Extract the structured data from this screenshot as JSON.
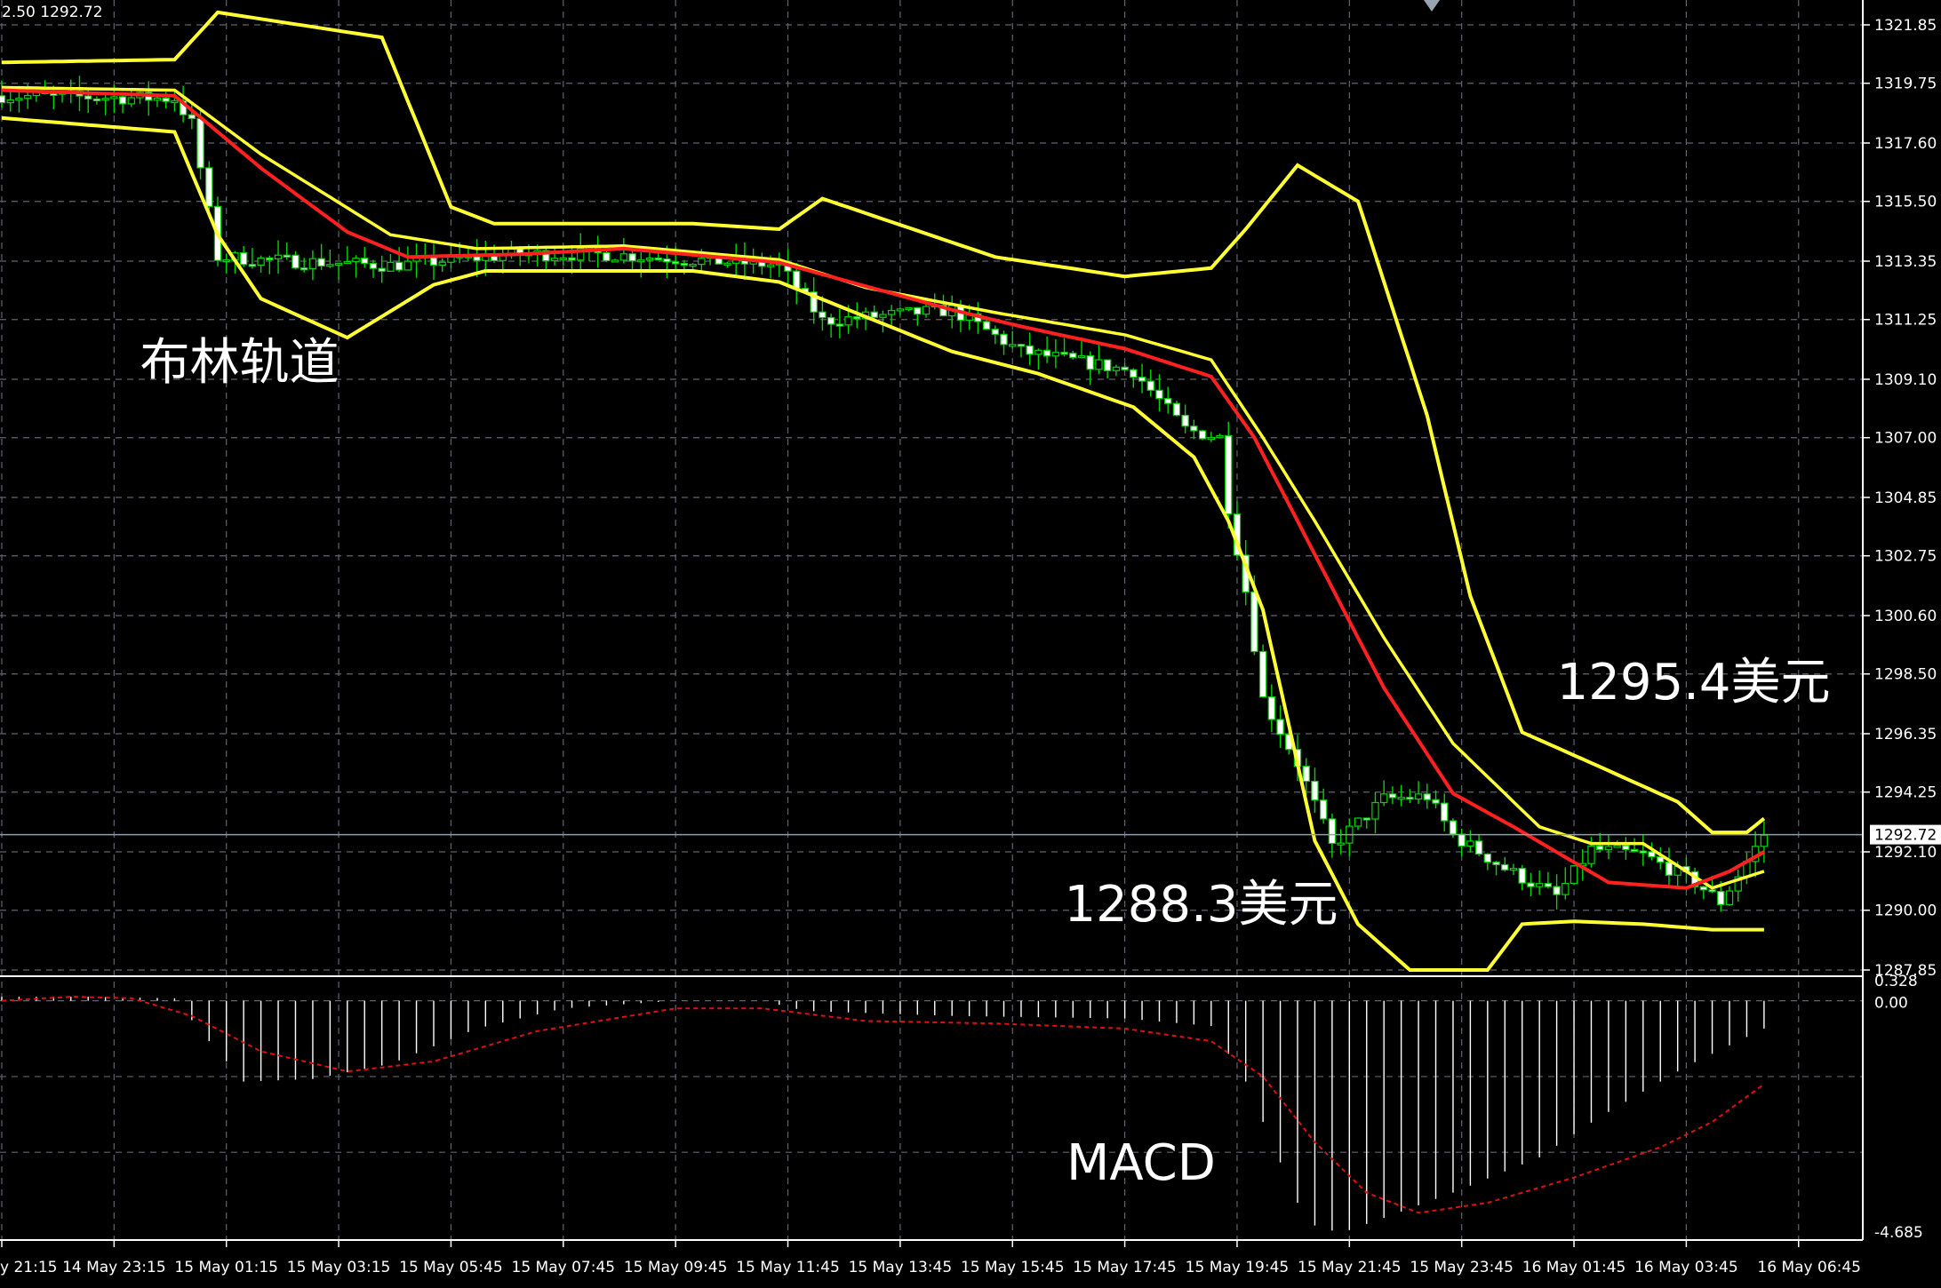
{
  "header": {
    "info": "2.50 1292.72"
  },
  "chart_data": [
    {
      "type": "candlestick",
      "overlays": [
        "bollinger-bands",
        "moving-average"
      ],
      "grid": true,
      "grid_style": "dashed",
      "background": "#000000",
      "current_price": 1292.72,
      "ylim": [
        1287.85,
        1321.85
      ],
      "y_ticks": [
        1321.85,
        1319.75,
        1317.6,
        1315.5,
        1313.35,
        1311.25,
        1309.1,
        1307.0,
        1304.85,
        1302.75,
        1300.6,
        1298.5,
        1296.35,
        1294.25,
        1292.1,
        1290.0,
        1287.85
      ],
      "y_tick_labels": [
        "1321.85",
        "1319.75",
        "1317.60",
        "1315.50",
        "1313.35",
        "1311.25",
        "1309.10",
        "1307.00",
        "1304.85",
        "1302.75",
        "1300.60",
        "1298.50",
        "1296.35",
        "1294.25",
        "1292.10",
        "1290.00",
        "1287.85"
      ],
      "x_ticks": [
        "y 21:15",
        "14 May 23:15",
        "15 May 01:15",
        "15 May 03:15",
        "15 May 05:45",
        "15 May 07:45",
        "15 May 09:45",
        "15 May 11:45",
        "15 May 13:45",
        "15 May 15:45",
        "15 May 17:45",
        "15 May 19:45",
        "15 May 21:45",
        "15 May 23:45",
        "16 May 01:45",
        "16 May 03:45",
        "16 May 06:45"
      ],
      "x_tick_index": [
        0,
        13,
        26,
        39,
        52,
        65,
        78,
        91,
        104,
        117,
        130,
        143,
        156,
        169,
        182,
        195,
        208
      ],
      "n_bars": 205,
      "anchor_closes": [
        [
          0,
          1319.3
        ],
        [
          20,
          1319.2
        ],
        [
          22,
          1318.3
        ],
        [
          25,
          1313.5
        ],
        [
          30,
          1313.4
        ],
        [
          45,
          1313.2
        ],
        [
          60,
          1313.6
        ],
        [
          70,
          1313.6
        ],
        [
          90,
          1313.2
        ],
        [
          95,
          1311.2
        ],
        [
          110,
          1311.6
        ],
        [
          118,
          1310.1
        ],
        [
          131,
          1309.4
        ],
        [
          137,
          1307.3
        ],
        [
          141,
          1307.0
        ],
        [
          142,
          1304.5
        ],
        [
          144,
          1301.5
        ],
        [
          146,
          1297.6
        ],
        [
          150,
          1295.3
        ],
        [
          154,
          1292.3
        ],
        [
          160,
          1294.0
        ],
        [
          165,
          1294.1
        ],
        [
          168,
          1292.7
        ],
        [
          174,
          1291.5
        ],
        [
          180,
          1290.5
        ],
        [
          184,
          1292.2
        ],
        [
          190,
          1292.0
        ],
        [
          196,
          1291.0
        ],
        [
          199,
          1290.3
        ],
        [
          204,
          1292.72
        ]
      ],
      "anchor_upper": [
        [
          0,
          1320.5
        ],
        [
          20,
          1320.6
        ],
        [
          25,
          1322.3
        ],
        [
          44,
          1321.4
        ],
        [
          52,
          1315.3
        ],
        [
          57,
          1314.7
        ],
        [
          80,
          1314.7
        ],
        [
          90,
          1314.5
        ],
        [
          95,
          1315.6
        ],
        [
          115,
          1313.5
        ],
        [
          130,
          1312.8
        ],
        [
          140,
          1313.1
        ],
        [
          144,
          1314.5
        ],
        [
          150,
          1316.8
        ],
        [
          157,
          1315.5
        ],
        [
          165,
          1307.8
        ],
        [
          170,
          1301.3
        ],
        [
          176,
          1296.4
        ],
        [
          184,
          1295.3
        ],
        [
          194,
          1293.9
        ],
        [
          198,
          1292.8
        ],
        [
          202,
          1292.8
        ],
        [
          204,
          1293.3
        ]
      ],
      "anchor_mid": [
        [
          0,
          1319.5
        ],
        [
          20,
          1319.3
        ],
        [
          30,
          1316.7
        ],
        [
          40,
          1314.4
        ],
        [
          47,
          1313.5
        ],
        [
          60,
          1313.6
        ],
        [
          72,
          1313.8
        ],
        [
          90,
          1313.3
        ],
        [
          110,
          1311.6
        ],
        [
          118,
          1311.0
        ],
        [
          130,
          1310.2
        ],
        [
          140,
          1309.2
        ],
        [
          145,
          1307.0
        ],
        [
          150,
          1304.0
        ],
        [
          160,
          1298.0
        ],
        [
          168,
          1294.2
        ],
        [
          175,
          1293.0
        ],
        [
          186,
          1291.0
        ],
        [
          195,
          1290.8
        ],
        [
          200,
          1291.4
        ],
        [
          204,
          1292.1
        ]
      ],
      "anchor_outer": [
        [
          0,
          1319.6
        ],
        [
          20,
          1319.5
        ],
        [
          30,
          1317.2
        ],
        [
          45,
          1314.3
        ],
        [
          55,
          1313.8
        ],
        [
          72,
          1313.9
        ],
        [
          90,
          1313.4
        ],
        [
          100,
          1312.4
        ],
        [
          115,
          1311.5
        ],
        [
          130,
          1310.7
        ],
        [
          140,
          1309.8
        ],
        [
          146,
          1307.0
        ],
        [
          152,
          1304.0
        ],
        [
          160,
          1299.8
        ],
        [
          168,
          1296.0
        ],
        [
          178,
          1293.0
        ],
        [
          184,
          1292.4
        ],
        [
          190,
          1292.4
        ],
        [
          198,
          1290.8
        ],
        [
          204,
          1291.4
        ]
      ],
      "anchor_lower": [
        [
          0,
          1318.5
        ],
        [
          20,
          1318.0
        ],
        [
          25,
          1314.3
        ],
        [
          30,
          1312.0
        ],
        [
          40,
          1310.6
        ],
        [
          50,
          1312.5
        ],
        [
          56,
          1313.0
        ],
        [
          80,
          1313.0
        ],
        [
          90,
          1312.6
        ],
        [
          110,
          1310.1
        ],
        [
          120,
          1309.3
        ],
        [
          131,
          1308.1
        ],
        [
          138,
          1306.3
        ],
        [
          142,
          1304.0
        ],
        [
          146,
          1300.8
        ],
        [
          152,
          1292.5
        ],
        [
          157,
          1289.5
        ],
        [
          163,
          1287.85
        ],
        [
          172,
          1287.85
        ],
        [
          176,
          1289.5
        ],
        [
          182,
          1289.6
        ],
        [
          190,
          1289.5
        ],
        [
          198,
          1289.3
        ],
        [
          204,
          1289.3
        ]
      ],
      "annotations": [
        {
          "text": "布林轨道",
          "price": 1309.1,
          "bar": 16
        },
        {
          "text": "1295.4美元",
          "price": 1297.6,
          "bar": 180
        },
        {
          "text": "1288.3美元",
          "price": 1289.6,
          "bar": 123
        }
      ]
    },
    {
      "type": "bar",
      "indicator": "MACD",
      "ylim": [
        -4.685,
        0.328
      ],
      "y_tick_labels": [
        "0.328",
        "0.00",
        "-4.685"
      ],
      "anchor_hist": [
        [
          0,
          0.08
        ],
        [
          10,
          0.08
        ],
        [
          20,
          0.05
        ],
        [
          23,
          -0.6
        ],
        [
          28,
          -1.6
        ],
        [
          36,
          -1.55
        ],
        [
          45,
          -1.25
        ],
        [
          55,
          -0.55
        ],
        [
          65,
          -0.15
        ],
        [
          78,
          0.0
        ],
        [
          88,
          0.0
        ],
        [
          93,
          -0.2
        ],
        [
          110,
          -0.3
        ],
        [
          130,
          -0.35
        ],
        [
          140,
          -0.5
        ],
        [
          144,
          -1.6
        ],
        [
          148,
          -3.2
        ],
        [
          151,
          -4.4
        ],
        [
          155,
          -4.6
        ],
        [
          160,
          -4.3
        ],
        [
          168,
          -3.8
        ],
        [
          178,
          -3.1
        ],
        [
          185,
          -2.3
        ],
        [
          195,
          -1.3
        ],
        [
          204,
          -0.55
        ]
      ],
      "anchor_signal": [
        [
          0,
          0.0
        ],
        [
          8,
          0.08
        ],
        [
          15,
          0.05
        ],
        [
          22,
          -0.3
        ],
        [
          30,
          -1.0
        ],
        [
          40,
          -1.4
        ],
        [
          50,
          -1.2
        ],
        [
          62,
          -0.6
        ],
        [
          78,
          -0.15
        ],
        [
          88,
          -0.15
        ],
        [
          100,
          -0.4
        ],
        [
          115,
          -0.45
        ],
        [
          130,
          -0.55
        ],
        [
          140,
          -0.8
        ],
        [
          146,
          -1.5
        ],
        [
          152,
          -2.8
        ],
        [
          158,
          -3.8
        ],
        [
          164,
          -4.2
        ],
        [
          172,
          -4.0
        ],
        [
          182,
          -3.5
        ],
        [
          192,
          -2.9
        ],
        [
          198,
          -2.4
        ],
        [
          204,
          -1.65
        ]
      ],
      "label": "MACD"
    }
  ],
  "colors": {
    "background": "#000000",
    "grid": "#5f6471",
    "candle_up_body": "#000000",
    "candle_down_body": "#ffffff",
    "candle_wick": "#00d400",
    "bollinger": "#ffff33",
    "ma_red": "#ff2020",
    "macd_hist": "#ffffff",
    "macd_signal": "#e01010",
    "axis_text": "#ffffff",
    "price_line": "#8aa0b0"
  }
}
